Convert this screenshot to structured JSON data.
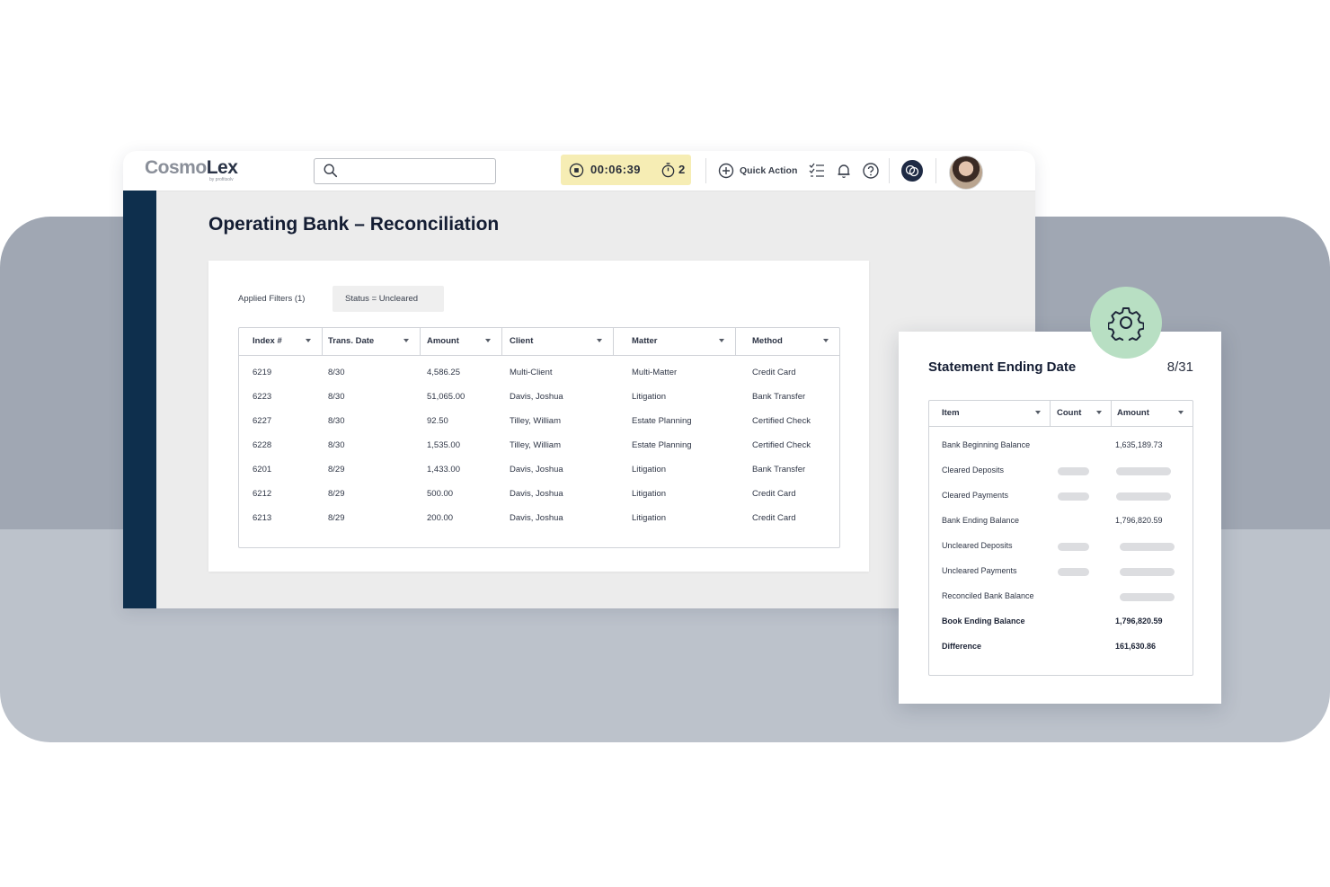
{
  "app": {
    "logo_prefix": "Cosmo",
    "logo_suffix": "Lex",
    "logo_sub": "by profitsolv",
    "timer": "00:06:39",
    "timer_count": "2",
    "quick_action": "Quick Action"
  },
  "page": {
    "title": "Operating Bank – Reconciliation"
  },
  "filters": {
    "label": "Applied Filters (1)",
    "chip": "Status = Uncleared"
  },
  "table": {
    "columns": [
      "Index #",
      "Trans. Date",
      "Amount",
      "Client",
      "Matter",
      "Method"
    ],
    "rows": [
      [
        "6219",
        "8/30",
        "4,586.25",
        "Multi-Client",
        "Multi-Matter",
        "Credit Card"
      ],
      [
        "6223",
        "8/30",
        "51,065.00",
        "Davis, Joshua",
        "Litigation",
        "Bank Transfer"
      ],
      [
        "6227",
        "8/30",
        "92.50",
        "Tilley, William",
        "Estate Planning",
        "Certified Check"
      ],
      [
        "6228",
        "8/30",
        "1,535.00",
        "Tilley, William",
        "Estate Planning",
        "Certified Check"
      ],
      [
        "6201",
        "8/29",
        "1,433.00",
        "Davis, Joshua",
        "Litigation",
        "Bank Transfer"
      ],
      [
        "6212",
        "8/29",
        "500.00",
        "Davis, Joshua",
        "Litigation",
        "Credit Card"
      ],
      [
        "6213",
        "8/29",
        "200.00",
        "Davis, Joshua",
        "Litigation",
        "Credit Card"
      ]
    ]
  },
  "statement": {
    "title": "Statement Ending Date",
    "date": "8/31",
    "columns": [
      "Item",
      "Count",
      "Amount"
    ],
    "rows": [
      {
        "item": "Bank Beginning Balance",
        "amount": "1,635,189.73"
      },
      {
        "item": "Cleared Deposits",
        "amount": ""
      },
      {
        "item": "Cleared Payments",
        "amount": ""
      },
      {
        "item": "Bank Ending Balance",
        "amount": "1,796,820.59"
      },
      {
        "item": "Uncleared Deposits",
        "amount": ""
      },
      {
        "item": "Uncleared Payments",
        "amount": ""
      },
      {
        "item": "Reconciled Bank Balance",
        "amount": ""
      },
      {
        "item": "Book Ending Balance",
        "amount": "1,796,820.59"
      },
      {
        "item": "Difference",
        "amount": "161,630.86"
      }
    ]
  },
  "colors": {
    "sidebar": "#0e2f4d",
    "timer_bg": "#f6edb4",
    "gear_badge": "#b8dfc3",
    "band_top": "#a0a7b3",
    "band_bottom": "#bcc2cb"
  },
  "icons": [
    "search-icon",
    "timer-icon",
    "stopwatch-icon",
    "plus-circle-icon",
    "checklist-icon",
    "bell-icon",
    "help-icon",
    "chat-icon",
    "gear-icon"
  ]
}
